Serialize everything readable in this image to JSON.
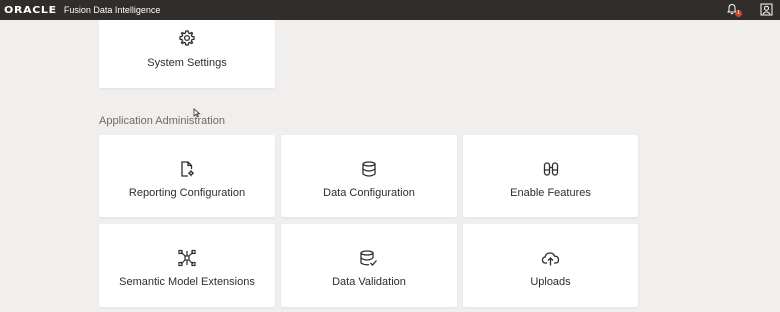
{
  "header": {
    "brand": "ORACLE",
    "product": "Fusion Data Intelligence",
    "notification_count": "1",
    "icons": [
      "notification-bell-icon",
      "user-profile-icon"
    ]
  },
  "system_section": {
    "cards": [
      {
        "label": "System Settings",
        "icon": "gear-icon"
      }
    ]
  },
  "app_admin": {
    "title": "Application Administration",
    "cards": [
      {
        "label": "Reporting Configuration",
        "icon": "report-config-icon"
      },
      {
        "label": "Data Configuration",
        "icon": "database-icon"
      },
      {
        "label": "Enable Features",
        "icon": "binoculars-icon"
      },
      {
        "label": "Semantic Model Extensions",
        "icon": "network-icon"
      },
      {
        "label": "Data Validation",
        "icon": "database-check-icon"
      },
      {
        "label": "Uploads",
        "icon": "cloud-upload-icon"
      }
    ]
  }
}
